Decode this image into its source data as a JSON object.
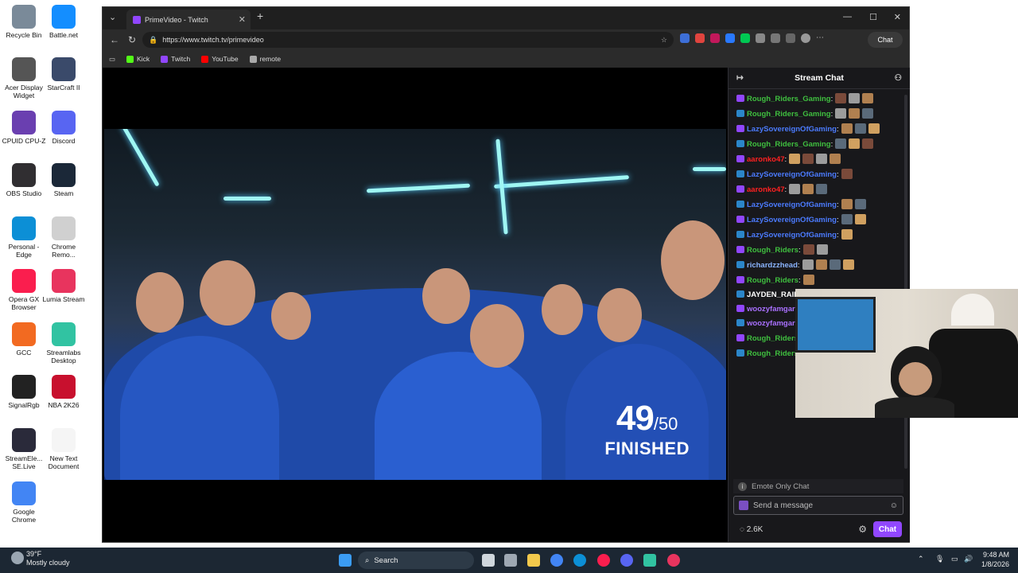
{
  "desktop": {
    "icons": [
      {
        "label": "Recycle Bin",
        "icon": "recycle-bin-icon",
        "color": "#7a8a99"
      },
      {
        "label": "Battle.net",
        "icon": "battlenet-icon",
        "color": "#148eff"
      },
      {
        "label": "Acer Display Widget",
        "icon": "acer-display-icon",
        "color": "#555555"
      },
      {
        "label": "StarCraft II",
        "icon": "starcraft-icon",
        "color": "#3a4a6a"
      },
      {
        "label": "CPUID CPU-Z",
        "icon": "cpuz-icon",
        "color": "#6a3fb0"
      },
      {
        "label": "Discord",
        "icon": "discord-icon",
        "color": "#5865f2"
      },
      {
        "label": "OBS Studio",
        "icon": "obs-icon",
        "color": "#302e31"
      },
      {
        "label": "Steam",
        "icon": "steam-icon",
        "color": "#1b2838"
      },
      {
        "label": "Personal - Edge",
        "icon": "edge-icon",
        "color": "#0c8fd6"
      },
      {
        "label": "Chrome Remo...",
        "icon": "chrome-remote-icon",
        "color": "#d0d0d0"
      },
      {
        "label": "Opera GX Browser",
        "icon": "opera-gx-icon",
        "color": "#fa1e4e"
      },
      {
        "label": "Lumia Stream",
        "icon": "lumia-icon",
        "color": "#e8345e"
      },
      {
        "label": "GCC",
        "icon": "gcc-icon",
        "color": "#f26a21"
      },
      {
        "label": "Streamlabs Desktop",
        "icon": "streamlabs-icon",
        "color": "#31c3a2"
      },
      {
        "label": "SignalRgb",
        "icon": "signalrgb-icon",
        "color": "#222222"
      },
      {
        "label": "NBA 2K26",
        "icon": "nba2k-icon",
        "color": "#c8102e"
      },
      {
        "label": "StreamEle... SE.Live",
        "icon": "streamelements-icon",
        "color": "#2a2a3a"
      },
      {
        "label": "New Text Document",
        "icon": "text-document-icon",
        "color": "#f5f5f5"
      },
      {
        "label": "Google Chrome",
        "icon": "chrome-icon",
        "color": "#4285f4"
      }
    ]
  },
  "browser": {
    "tab_title": "PrimeVideo - Twitch",
    "url": "https://www.twitch.tv/primevideo",
    "copilot_label": "Chat",
    "bookmarks": [
      {
        "label": "Kick",
        "color": "#53fc18"
      },
      {
        "label": "Twitch",
        "color": "#9146ff"
      },
      {
        "label": "YouTube",
        "color": "#ff0000"
      },
      {
        "label": "remote",
        "color": "#aaaaaa"
      }
    ]
  },
  "video": {
    "score": "49",
    "score_total": "/50",
    "status": "FINISHED"
  },
  "chat": {
    "title": "Stream Chat",
    "lines": [
      {
        "user": "Rough_Riders_Gaming",
        "color": "#3fbf3f",
        "emotes": 3
      },
      {
        "user": "Rough_Riders_Gaming",
        "color": "#3fbf3f",
        "emotes": 3
      },
      {
        "user": "LazySovereignOfGaming",
        "color": "#4b7bff",
        "emotes": 3
      },
      {
        "user": "Rough_Riders_Gaming",
        "color": "#3fbf3f",
        "emotes": 3
      },
      {
        "user": "aaronko47",
        "color": "#ff2020",
        "emotes": 4
      },
      {
        "user": "LazySovereignOfGaming",
        "color": "#4b7bff",
        "emotes": 1
      },
      {
        "user": "aaronko47",
        "color": "#ff2020",
        "emotes": 3
      },
      {
        "user": "LazySovereignOfGaming",
        "color": "#4b7bff",
        "emotes": 2
      },
      {
        "user": "LazySovereignOfGaming",
        "color": "#4b7bff",
        "emotes": 2
      },
      {
        "user": "LazySovereignOfGaming",
        "color": "#4b7bff",
        "emotes": 1
      },
      {
        "user": "Rough_Riders",
        "color": "#3fbf3f",
        "emotes": 2
      },
      {
        "user": "richardzzhead",
        "color": "#8ab4ff",
        "emotes": 4
      },
      {
        "user": "Rough_Riders",
        "color": "#3fbf3f",
        "emotes": 1
      },
      {
        "user": "JAYDEN_RAIN",
        "color": "#ffffff",
        "emotes": 0
      },
      {
        "user": "woozyfamgar",
        "color": "#a970ff",
        "emotes": 0
      },
      {
        "user": "woozyfamgar",
        "color": "#a970ff",
        "emotes": 0
      },
      {
        "user": "Rough_Riders_Gaming",
        "color": "#3fbf3f",
        "emotes": 4
      },
      {
        "user": "Rough_Riders_Gaming",
        "color": "#3fbf3f",
        "emotes": 3
      }
    ],
    "emote_only": "Emote Only Chat",
    "input_placeholder": "Send a message",
    "viewers": "2.6K",
    "send_label": "Chat"
  },
  "taskbar": {
    "weather_temp": "39°F",
    "weather_desc": "Mostly cloudy",
    "search_placeholder": "Search",
    "time": "9:48 AM",
    "date": "1/8/2026"
  }
}
